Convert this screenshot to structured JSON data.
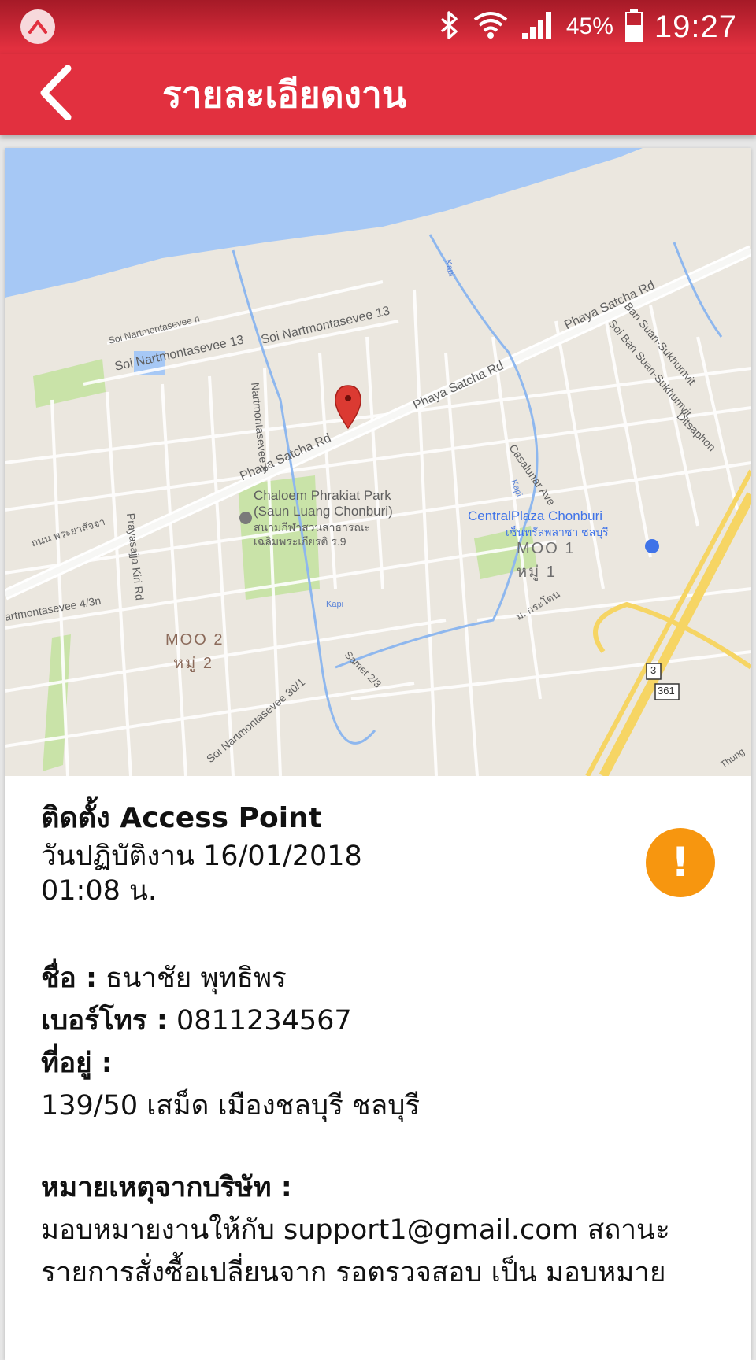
{
  "status_bar": {
    "battery": "45%",
    "time": "19:27",
    "icons": [
      "app-badge-icon",
      "bluetooth-icon",
      "wifi-icon",
      "signal-icon",
      "battery-icon"
    ]
  },
  "header": {
    "title": "รายละเอียดงาน",
    "back_icon": "chevron-left-icon"
  },
  "map": {
    "labels": {
      "road1": "Phaya Satcha Rd",
      "road2": "Phaya Satcha Rd",
      "road3": "Phaya Satcha Rd",
      "soi13a": "Soi Nartmontasevee 13",
      "soi13b": "Soi Nartmontasevee 13",
      "soin": "Soi Nartmontasevee n",
      "nart9": "Nartmontasevee 9",
      "park_en1": "Chaloem Phrakiat Park",
      "park_en2": "(Saun Luang Chonburi)",
      "park_th1": "สนามกีฬาสวนสาธารณะ",
      "park_th2": "เฉลิมพระเกียรติ ร.9",
      "central_en": "CentralPlaza Chonburi",
      "central_th": "เซ็นทรัลพลาซา ชลบุรี",
      "moo1_en": "MOO 1",
      "moo1_th": "หมู่ 1",
      "moo2_en": "MOO 2",
      "moo2_th": "หมู่ 2",
      "kiri": "Prayasajja Kiri Rd",
      "nart43": "artmontasevee 4/3n",
      "nart301": "Soi Nartmontasevee 30/1",
      "samet": "Samet 2/3",
      "casalunar": "Casalunar Ave",
      "bansuan1": "Ban Suan-Sukhumvit",
      "bansuan2": "Soi Ban Suan-Sukhumvit",
      "ditsaphon": "Ditsaphon",
      "thanon_th": "ถนน พระยาสัจจา",
      "kapi1": "Kapi",
      "kapi2": "Kapi",
      "kapi3": "Kapi",
      "route3": "3",
      "route361": "361",
      "thung": "Thung",
      "kradon": "ม. กระโดน"
    }
  },
  "job": {
    "title": "ติดตั้ง Access Point",
    "date_line": "วันปฏิบัติงาน 16/01/2018",
    "time_line": "01:08 น.",
    "status_icon": "exclamation-icon",
    "status_symbol": "!",
    "status_color": "#f7960f"
  },
  "customer": {
    "name_label": "ชื่อ :",
    "name_value": "ธนาชัย พุทธิพร",
    "phone_label": "เบอร์โทร :",
    "phone_value": "0811234567",
    "address_label": "ที่อยู่ :",
    "address_value": "139/50 เสม็ด เมืองชลบุรี ชลบุรี"
  },
  "note": {
    "label": "หมายเหตุจากบริษัท :",
    "line1": "มอบหมายงานให้กับ support1@gmail.com สถานะ",
    "line2": "รายการสั่งซื้อเปลี่ยนจาก รอตรวจสอบ เป็น มอบหมาย"
  },
  "colors": {
    "primary": "#e2303f",
    "warning": "#f7960f",
    "water": "#a6c8f5",
    "park": "#c9e3a8",
    "pin": "#db3a32"
  }
}
